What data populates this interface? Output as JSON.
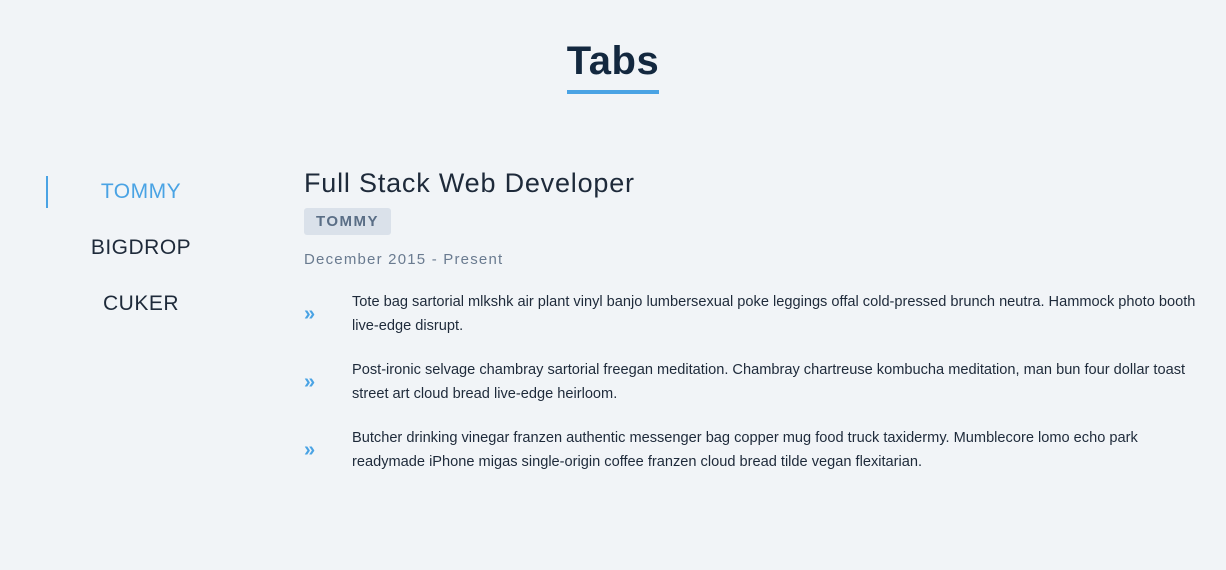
{
  "page_title": "Tabs",
  "tabs": [
    {
      "label": "TOMMY",
      "active": true
    },
    {
      "label": "BIGDROP",
      "active": false
    },
    {
      "label": "CUKER",
      "active": false
    }
  ],
  "panel": {
    "job_title": "Full Stack Web Developer",
    "company": "TOMMY",
    "dates": "December 2015 - Present",
    "duties": [
      "Tote bag sartorial mlkshk air plant vinyl banjo lumbersexual poke leggings offal cold-pressed brunch neutra. Hammock photo booth live-edge disrupt.",
      "Post-ironic selvage chambray sartorial freegan meditation. Chambray chartreuse kombucha meditation, man bun four dollar toast street art cloud bread live-edge heirloom.",
      "Butcher drinking vinegar franzen authentic messenger bag copper mug food truck taxidermy. Mumblecore lomo echo park readymade iPhone migas single-origin coffee franzen cloud bread tilde vegan flexitarian."
    ],
    "bullet_icon": "double-chevron-right-icon"
  },
  "colors": {
    "accent": "#4aa3e4",
    "background": "#f1f4f7",
    "heading": "#13283f"
  }
}
